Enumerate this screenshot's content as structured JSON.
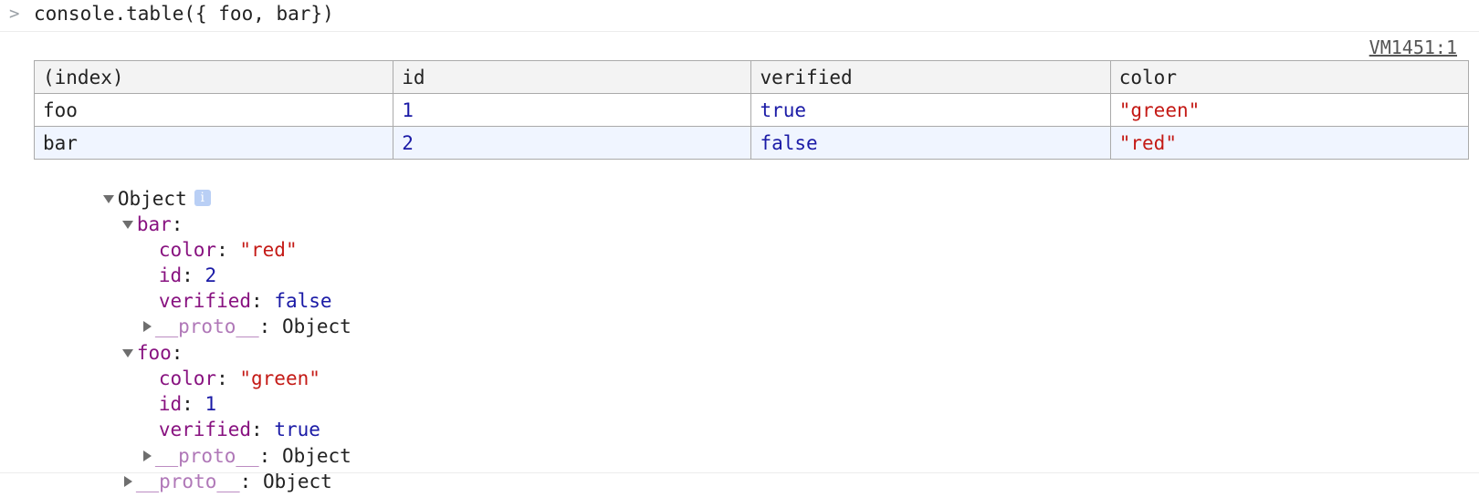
{
  "console": {
    "prompt_symbol": ">",
    "command": "console.table({ foo, bar})",
    "source_link": "VM1451:1"
  },
  "table": {
    "headers": [
      "(index)",
      "id",
      "verified",
      "color"
    ],
    "rows": [
      {
        "index": "foo",
        "id": "1",
        "verified": "true",
        "color": "\"green\""
      },
      {
        "index": "bar",
        "id": "2",
        "verified": "false",
        "color": "\"red\""
      }
    ]
  },
  "tree": {
    "root_label": "Object",
    "info_glyph": "i",
    "bar": {
      "key": "bar",
      "color_key": "color",
      "color_value": "\"red\"",
      "id_key": "id",
      "id_value": "2",
      "verified_key": "verified",
      "verified_value": "false",
      "proto_key": "__proto__",
      "proto_value": "Object"
    },
    "foo": {
      "key": "foo",
      "color_key": "color",
      "color_value": "\"green\"",
      "id_key": "id",
      "id_value": "1",
      "verified_key": "verified",
      "verified_value": "true",
      "proto_key": "__proto__",
      "proto_value": "Object"
    },
    "root_proto_key": "__proto__",
    "root_proto_value": "Object"
  },
  "colors": {
    "key_purple": "#881280",
    "number_blue": "#1a1aa6",
    "string_red": "#c41a16",
    "row_highlight": "#f0f5ff"
  }
}
